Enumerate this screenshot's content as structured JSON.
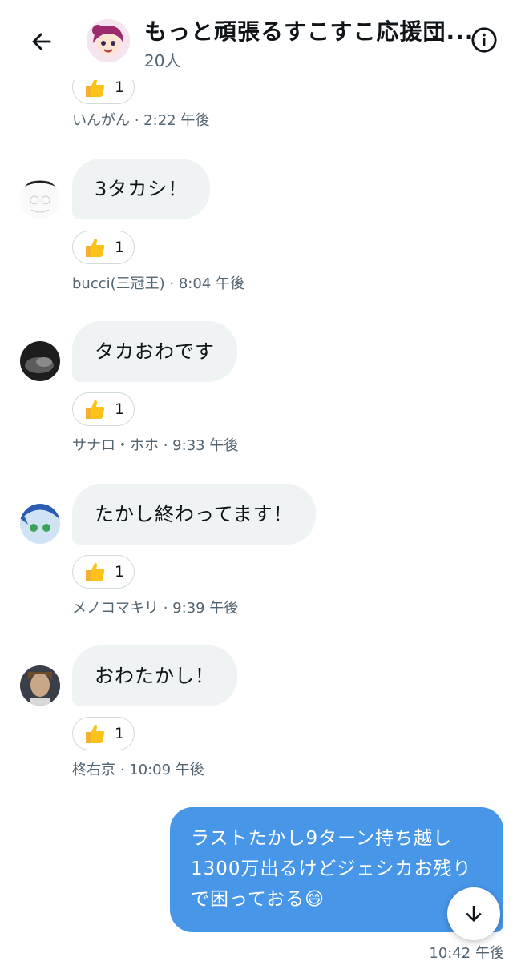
{
  "header": {
    "title": "もっと頑張るすこすこ応援団...",
    "member_count": "20人"
  },
  "messages": [
    {
      "sender": "いんがん",
      "time": "2:22 午後",
      "text": "",
      "reaction_count": "1",
      "partial": true
    },
    {
      "sender": "bucci(三冠王)",
      "time": "8:04 午後",
      "text": "3タカシ！",
      "reaction_count": "1"
    },
    {
      "sender": "サナロ・ホホ",
      "time": "9:33 午後",
      "text": "タカおわです",
      "reaction_count": "1"
    },
    {
      "sender": "メノコマキリ",
      "time": "9:39 午後",
      "text": "たかし終わってます！",
      "reaction_count": "1"
    },
    {
      "sender": "柊右京",
      "time": "10:09 午後",
      "text": "おわたかし！",
      "reaction_count": "1"
    }
  ],
  "meta_separator": " · ",
  "own_message": {
    "lines": [
      "ラストたかし9ターン持ち越し",
      "1300万出るけどジェシカお残り",
      "で困っておる😄"
    ],
    "time": "10:42 午後"
  },
  "colors": {
    "own_bubble": "#4796e8",
    "other_bubble": "#eff3f4",
    "meta_text": "#536471"
  }
}
